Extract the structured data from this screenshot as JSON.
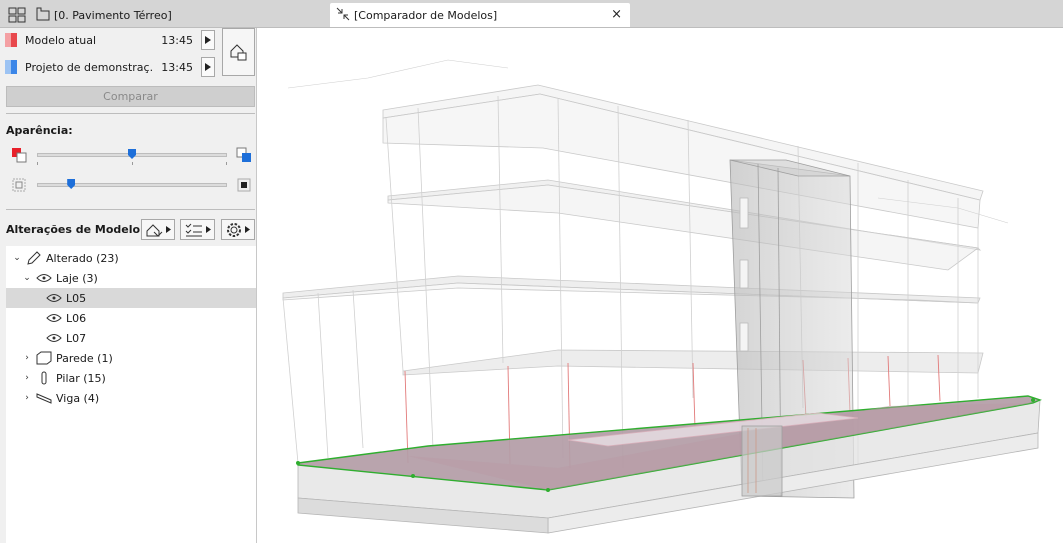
{
  "tabs": {
    "plan_tab": "[0. Pavimento Térreo]",
    "compare_tab": "[Comparador de Modelos]",
    "close_glyph": "×"
  },
  "models": [
    {
      "name": "Modelo atual",
      "time": "13:45",
      "color": "#e8474c"
    },
    {
      "name": "Projeto de demonstraç...",
      "time": "13:45",
      "color": "#3b86e8"
    }
  ],
  "compare_button": "Comparar",
  "appearance": {
    "label": "Aparência:",
    "slider1_value": 0.5,
    "slider2_value": 0.18
  },
  "changes": {
    "label": "Alterações de Modelo:"
  },
  "tree": [
    {
      "label": "Alterado (23)",
      "icon": "pencil-icon",
      "level": 0,
      "expanded": true
    },
    {
      "label": "Laje (3)",
      "icon": "eye-icon",
      "level": 1,
      "expanded": true
    },
    {
      "label": "L05",
      "icon": "eye-icon",
      "level": 2,
      "selected": true
    },
    {
      "label": "L06",
      "icon": "eye-icon",
      "level": 2
    },
    {
      "label": "L07",
      "icon": "eye-icon",
      "level": 2
    },
    {
      "label": "Parede (1)",
      "icon": "wall-icon",
      "level": 1,
      "expanded": false
    },
    {
      "label": "Pilar (15)",
      "icon": "column-icon",
      "level": 1,
      "expanded": false
    },
    {
      "label": "Viga (4)",
      "icon": "beam-icon",
      "level": 1,
      "expanded": false
    }
  ],
  "colors": {
    "accent": "#1e6fd9",
    "slab_highlight": "#2fae2f",
    "changed_floor": "#a88c98"
  }
}
